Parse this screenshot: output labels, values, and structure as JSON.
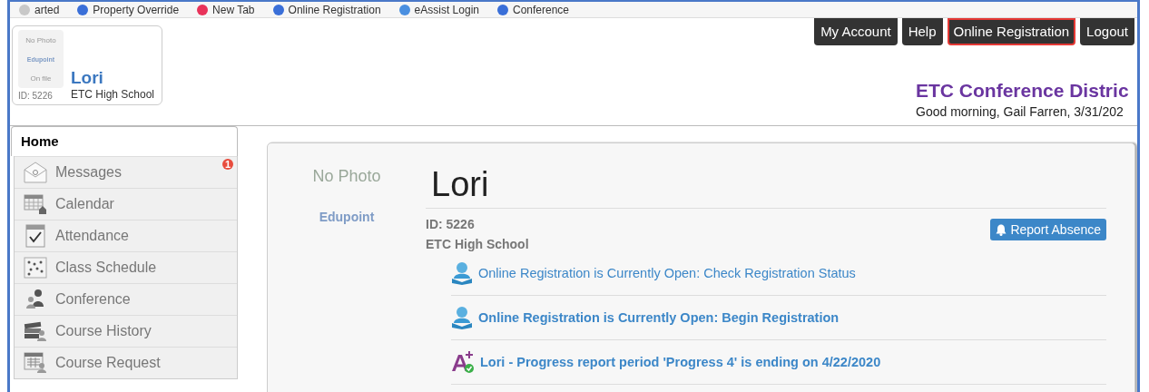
{
  "bookmarks": [
    {
      "label": "arted",
      "color": "#c8c8c8"
    },
    {
      "label": "Property Override",
      "color": "#3a6fd8"
    },
    {
      "label": "New Tab",
      "color": "#e8335a"
    },
    {
      "label": "Online Registration",
      "color": "#3a6fd8"
    },
    {
      "label": "eAssist Login",
      "color": "#4a8fe0"
    },
    {
      "label": "Conference",
      "color": "#3a6fd8"
    }
  ],
  "profile_card": {
    "photo_top": "No Photo",
    "photo_logo": "Edupoint",
    "photo_bottom": "On file",
    "id": "ID: 5226",
    "name": "Lori",
    "school": "ETC High School"
  },
  "top_buttons": [
    {
      "label": "My Account",
      "highlighted": false
    },
    {
      "label": "Help",
      "highlighted": false
    },
    {
      "label": "Online Registration",
      "highlighted": true
    },
    {
      "label": "Logout",
      "highlighted": false
    }
  ],
  "district": {
    "title": "ETC Conference Distric",
    "greeting": "Good morning, Gail Farren, 3/31/202"
  },
  "sidebar": {
    "home_tab": {
      "label": "Home",
      "selected": true
    },
    "items": [
      {
        "label": "Messages",
        "kind": "messages",
        "badge": "1"
      },
      {
        "label": "Calendar",
        "kind": "calendar"
      },
      {
        "label": "Attendance",
        "kind": "attendance"
      },
      {
        "label": "Class Schedule",
        "kind": "schedule"
      },
      {
        "label": "Conference",
        "kind": "conference"
      },
      {
        "label": "Course History",
        "kind": "history"
      },
      {
        "label": "Course Request",
        "kind": "request"
      }
    ]
  },
  "student": {
    "photo_text": "No Photo",
    "photo_logo": "Edupoint",
    "name": "Lori",
    "id": "ID: 5226",
    "school": "ETC High School",
    "report_button": "Report Absence"
  },
  "notices": [
    {
      "text": "Online Registration is Currently Open: Check Registration Status",
      "kind": "registration",
      "bold": false
    },
    {
      "text": "Online Registration is Currently Open: Begin Registration",
      "kind": "registration",
      "bold": true
    },
    {
      "text": "Lori - Progress report period 'Progress 4' is ending on 4/22/2020",
      "kind": "grade",
      "bold": true
    }
  ]
}
